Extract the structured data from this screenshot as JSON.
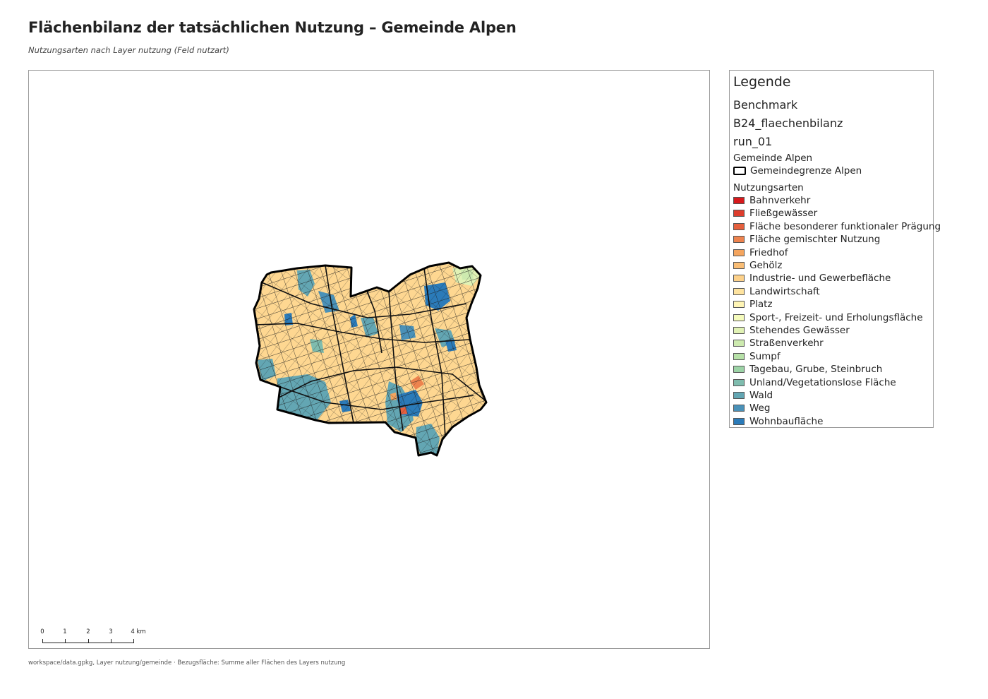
{
  "title": "Flächenbilanz der tatsächlichen Nutzung – Gemeinde Alpen",
  "subtitle": "Nutzungsarten nach Layer nutzung (Feld nutzart)",
  "footer": "workspace/data.gpkg, Layer nutzung/gemeinde · Bezugsfläche: Summe aller Flächen des Layers nutzung",
  "scalebar": {
    "labels": [
      "0",
      "1",
      "2",
      "3",
      "4 km"
    ]
  },
  "legend": {
    "title": "Legende",
    "lines": [
      "Benchmark",
      "B24_flaechenbilanz",
      "run_01"
    ],
    "boundary_group": {
      "label": "Gemeinde Alpen",
      "item": "Gemeindegrenze Alpen"
    },
    "landuse_group": {
      "label": "Nutzungsarten",
      "items": [
        {
          "label": "Bahnverkehr",
          "color": "#d7191c"
        },
        {
          "label": "Fließgewässer",
          "color": "#dd3d2d"
        },
        {
          "label": "Fläche besonderer funktionaler Prägung",
          "color": "#e5603e"
        },
        {
          "label": "Fläche gemischter Nutzung",
          "color": "#ed834e"
        },
        {
          "label": "Friedhof",
          "color": "#f4a55f"
        },
        {
          "label": "Gehölz",
          "color": "#f9bd75"
        },
        {
          "label": "Industrie- und Gewerbefläche",
          "color": "#fdd18a"
        },
        {
          "label": "Landwirtschaft",
          "color": "#fee39f"
        },
        {
          "label": "Platz",
          "color": "#fff5b5"
        },
        {
          "label": "Sport-, Freizeit- und Erholungsfläche",
          "color": "#f5fbbc"
        },
        {
          "label": "Stehendes Gewässer",
          "color": "#e1f2b5"
        },
        {
          "label": "Straßenverkehr",
          "color": "#cdeaaf"
        },
        {
          "label": "Sumpf",
          "color": "#b7e1a8"
        },
        {
          "label": "Tagebau, Grube, Steinbruch",
          "color": "#9cd3a6"
        },
        {
          "label": "Unland/Vegetationslose Fläche",
          "color": "#7fbcae"
        },
        {
          "label": "Wald",
          "color": "#63a6b3"
        },
        {
          "label": "Weg",
          "color": "#4a91b8"
        },
        {
          "label": "Wohnbaufläche",
          "color": "#2b7bb9"
        }
      ]
    }
  }
}
